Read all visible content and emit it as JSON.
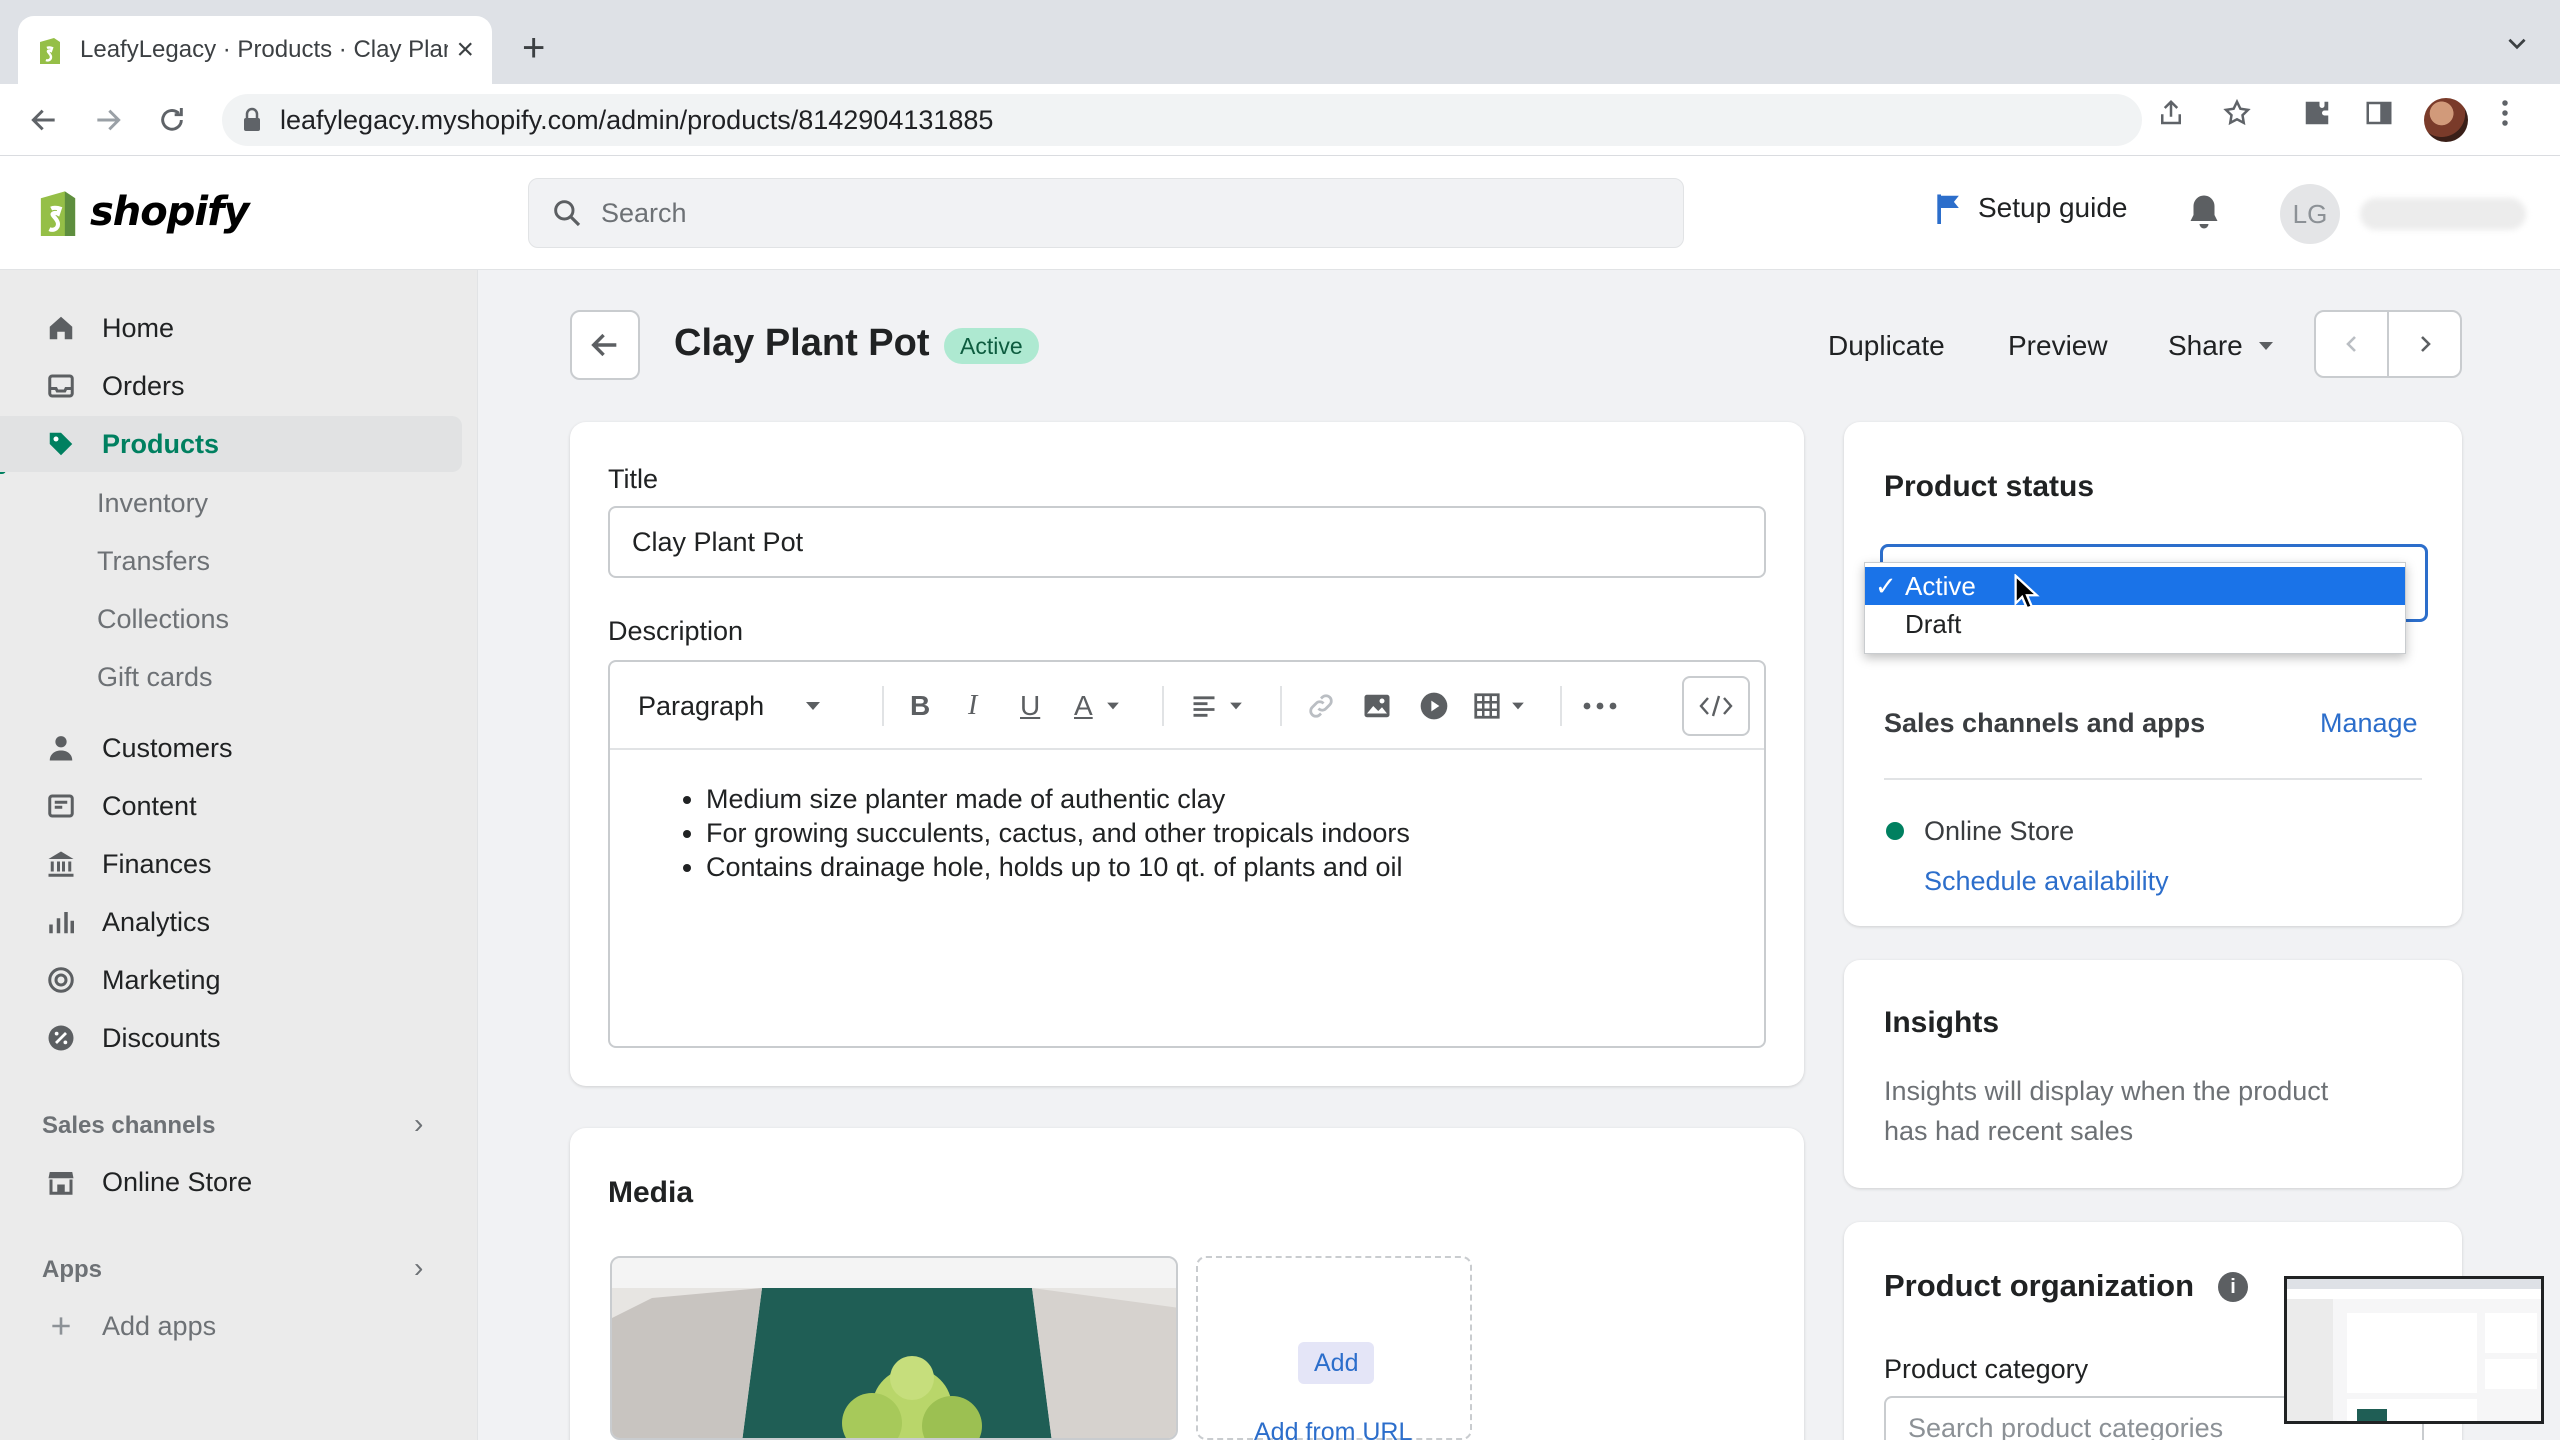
{
  "browser": {
    "tab_title": "LeafyLegacy · Products · Clay Plant Pot",
    "url": "leafylegacy.myshopify.com/admin/products/8142904131885"
  },
  "header": {
    "logo": "shopify",
    "search_placeholder": "Search",
    "setup_guide": "Setup guide",
    "user_initials": "LG"
  },
  "sidebar": {
    "items": [
      {
        "label": "Home",
        "icon": "home-icon"
      },
      {
        "label": "Orders",
        "icon": "inbox-icon"
      },
      {
        "label": "Products",
        "icon": "tag-icon"
      },
      {
        "label": "Customers",
        "icon": "person-icon"
      },
      {
        "label": "Content",
        "icon": "content-icon"
      },
      {
        "label": "Finances",
        "icon": "bank-icon"
      },
      {
        "label": "Analytics",
        "icon": "bar-chart-icon"
      },
      {
        "label": "Marketing",
        "icon": "target-icon"
      },
      {
        "label": "Discounts",
        "icon": "discount-icon"
      }
    ],
    "product_sub": [
      "Inventory",
      "Transfers",
      "Collections",
      "Gift cards"
    ],
    "sales_channels_label": "Sales channels",
    "online_store": "Online Store",
    "apps_label": "Apps",
    "add_apps": "Add apps"
  },
  "page": {
    "title": "Clay Plant Pot",
    "status_badge": "Active",
    "actions": {
      "duplicate": "Duplicate",
      "preview": "Preview",
      "share": "Share"
    }
  },
  "product_form": {
    "title_label": "Title",
    "title_value": "Clay Plant Pot",
    "description_label": "Description",
    "paragraph_select": "Paragraph",
    "description_bullets": [
      "Medium size planter made of authentic clay",
      "For growing succulents, cactus, and other tropicals indoors",
      "Contains drainage hole, holds up to 10 qt. of plants and oil"
    ]
  },
  "media": {
    "heading": "Media",
    "add_button": "Add",
    "add_from_url": "Add from URL"
  },
  "status_card": {
    "heading": "Product status",
    "options": [
      "Active",
      "Draft"
    ],
    "selected": "Active",
    "sales_channels_heading": "Sales channels and apps",
    "manage": "Manage",
    "channel": "Online Store",
    "schedule": "Schedule availability",
    "channel_dot_color": "#008060"
  },
  "insights": {
    "heading": "Insights",
    "text_line1": "Insights will display when the product",
    "text_line2": "has had recent sales"
  },
  "organization": {
    "heading": "Product organization",
    "category_label": "Product category",
    "category_placeholder": "Search product categories"
  },
  "colors": {
    "accent": "#008060",
    "link": "#2c6ecb",
    "badge_bg": "#aee9d1"
  }
}
